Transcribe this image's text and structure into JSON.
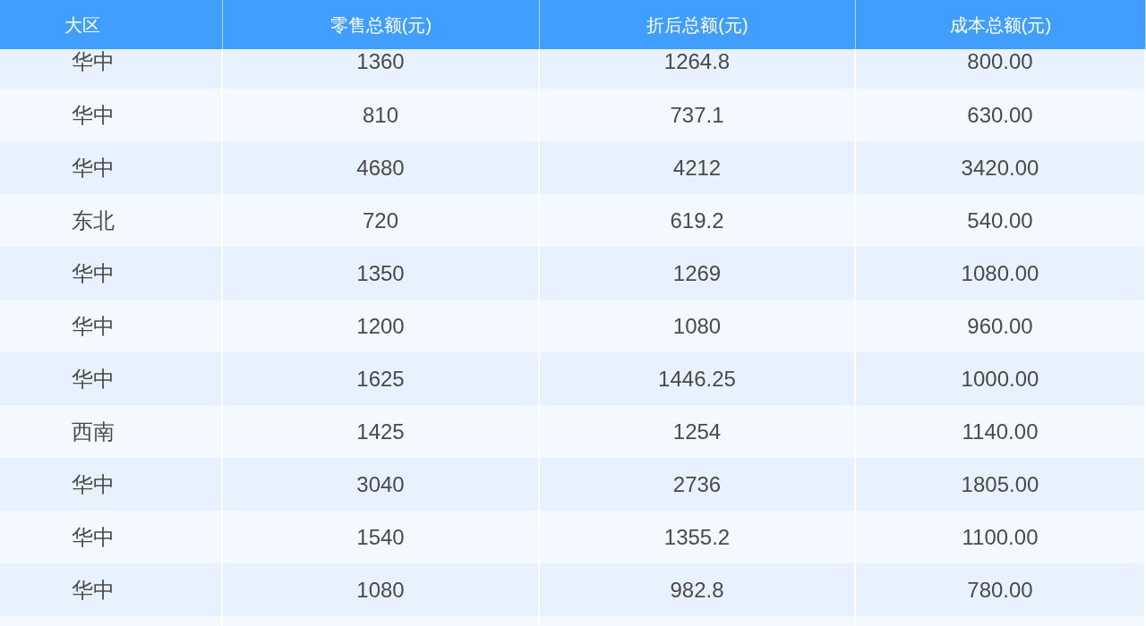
{
  "table": {
    "columns": [
      "大区",
      "零售总额(元)",
      "折后总额(元)",
      "成本总额(元)"
    ],
    "rows": [
      [
        "华中",
        "1360",
        "1264.8",
        "800.00"
      ],
      [
        "华中",
        "810",
        "737.1",
        "630.00"
      ],
      [
        "华中",
        "4680",
        "4212",
        "3420.00"
      ],
      [
        "东北",
        "720",
        "619.2",
        "540.00"
      ],
      [
        "华中",
        "1350",
        "1269",
        "1080.00"
      ],
      [
        "华中",
        "1200",
        "1080",
        "960.00"
      ],
      [
        "华中",
        "1625",
        "1446.25",
        "1000.00"
      ],
      [
        "西南",
        "1425",
        "1254",
        "1140.00"
      ],
      [
        "华中",
        "3040",
        "2736",
        "1805.00"
      ],
      [
        "华中",
        "1540",
        "1355.2",
        "1100.00"
      ],
      [
        "华中",
        "1080",
        "982.8",
        "780.00"
      ]
    ]
  }
}
